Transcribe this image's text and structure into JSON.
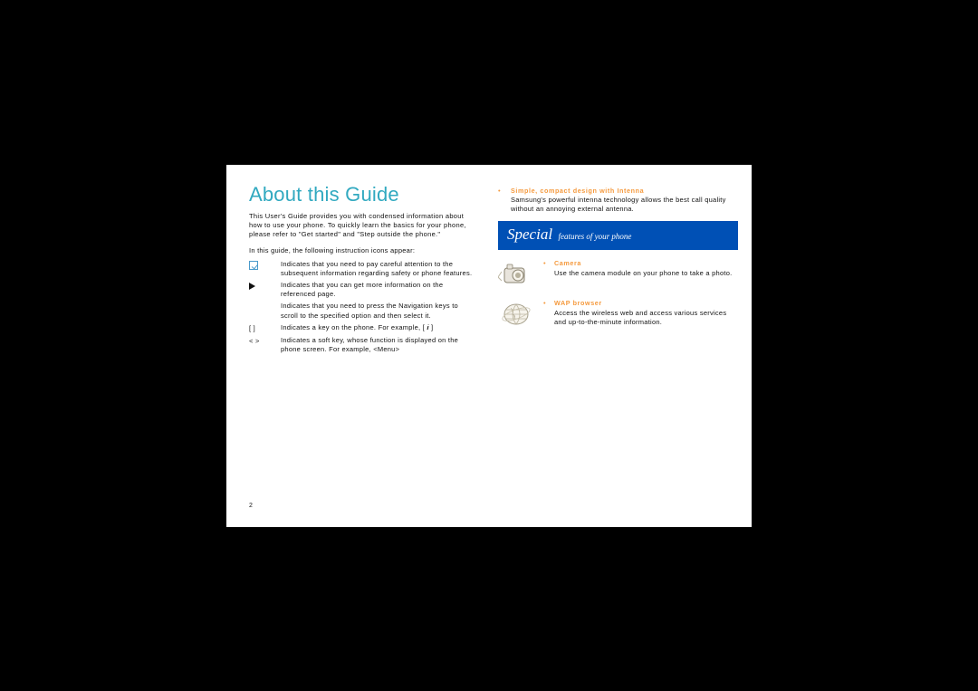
{
  "page_number": "2",
  "title": "About this Guide",
  "intro": "This User's Guide provides you with condensed information about how to use your phone. To quickly learn the basics for your phone, please refer to \"Get started\" and \"Step outside the phone.\"",
  "icons_line": "In this guide, the following instruction icons appear:",
  "icon_rows": [
    {
      "symbol": "check",
      "text": "Indicates that you need to pay careful attention to the subsequent information regarding safety or phone features."
    },
    {
      "symbol": "arrow",
      "text": "Indicates that you can get more information on the referenced page."
    },
    {
      "symbol": "",
      "text": "Indicates that you need to press the Navigation keys to scroll to the specified option and then select it."
    },
    {
      "symbol": "[    ]",
      "text": "Indicates a key on the phone. For example, [ 𝒊 ]"
    },
    {
      "symbol": "<    >",
      "text": "Indicates a soft key, whose function is displayed on the phone screen. For example, <Menu>"
    }
  ],
  "top_feature": {
    "title": "Simple, compact design with Intenna",
    "desc": "Samsung's powerful intenna technology allows the best call quality without an annoying external antenna."
  },
  "banner": {
    "main": "Special",
    "sub": "features of your phone"
  },
  "features": [
    {
      "icon": "camera",
      "title": "Camera",
      "desc": "Use the camera module on your phone to take a photo."
    },
    {
      "icon": "globe",
      "title": "WAP browser",
      "desc": "Access the wireless web and access various services and up-to-the-minute information."
    }
  ]
}
